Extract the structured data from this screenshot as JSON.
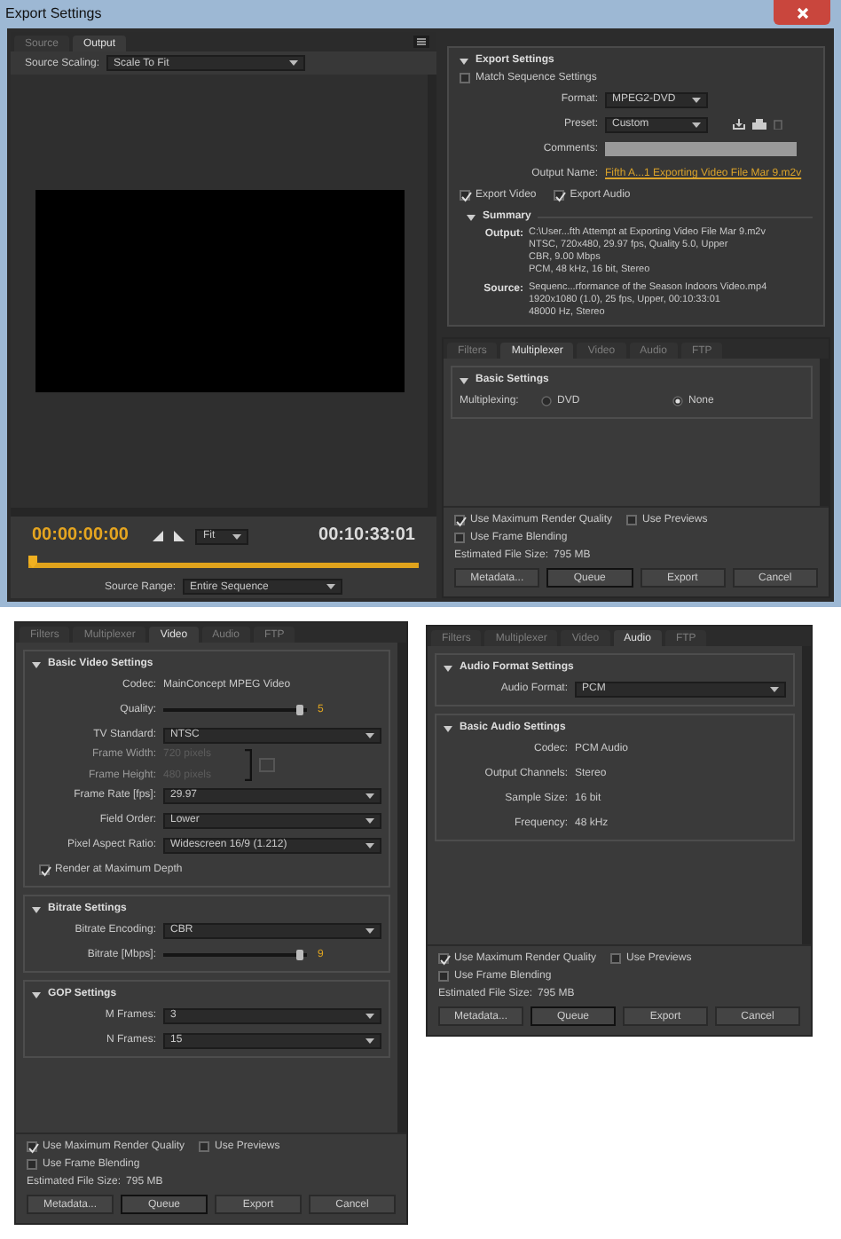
{
  "window": {
    "title": "Export Settings"
  },
  "preview": {
    "tabs": [
      {
        "label": "Source",
        "selected": false
      },
      {
        "label": "Output",
        "selected": true
      }
    ],
    "source_scaling": {
      "label": "Source Scaling:",
      "value": "Scale To Fit"
    },
    "timecode_current": "00:00:00:00",
    "zoom": "Fit",
    "timecode_duration": "00:10:33:01",
    "source_range": {
      "label": "Source Range:",
      "value": "Entire Sequence"
    }
  },
  "export_settings": {
    "heading": "Export Settings",
    "expanded": true,
    "match_sequence": {
      "label": "Match Sequence Settings",
      "checked": false
    },
    "fields": [
      {
        "kind": "dropdown",
        "label": "Format:",
        "value": "MPEG2-DVD"
      },
      {
        "kind": "preset",
        "label": "Preset:",
        "value": "Custom"
      },
      {
        "kind": "input",
        "label": "Comments:"
      },
      {
        "kind": "link",
        "label": "Output Name:",
        "value": "Fifth A...1 Exporting Video File Mar 9.m2v"
      }
    ],
    "exports": [
      {
        "label": "Export Video",
        "checked": true
      },
      {
        "label": "Export Audio",
        "checked": true
      }
    ],
    "summary": {
      "heading": "Summary",
      "expanded": true,
      "entries": [
        {
          "label": "Output:",
          "lines": [
            "C:\\User...fth Attempt at Exporting Video File Mar 9.m2v",
            "NTSC, 720x480, 29.97 fps, Quality 5.0, Upper",
            "CBR, 9.00 Mbps",
            "PCM, 48 kHz, 16 bit, Stereo"
          ]
        },
        {
          "label": "Source:",
          "lines": [
            "Sequenc...rformance of the Season Indoors Video.mp4",
            "1920x1080 (1.0), 25 fps, Upper, 00:10:33:01",
            "48000 Hz, Stereo"
          ]
        }
      ]
    }
  },
  "panels": [
    {
      "tabs": [
        {
          "label": "Filters",
          "selected": false
        },
        {
          "label": "Multiplexer",
          "selected": true
        },
        {
          "label": "Video",
          "selected": false
        },
        {
          "label": "Audio",
          "selected": false
        },
        {
          "label": "FTP",
          "selected": false
        }
      ],
      "sections": [
        {
          "heading": "Basic Settings",
          "expanded": true,
          "rows": [
            {
              "kind": "radio",
              "label": "Multiplexing:",
              "options": [
                {
                  "label": "DVD",
                  "selected": false
                },
                {
                  "label": "None",
                  "selected": true
                }
              ]
            }
          ]
        }
      ],
      "footer": {
        "checkboxes": [
          {
            "label": "Use Maximum Render Quality",
            "checked": true
          },
          {
            "label": "Use Previews",
            "checked": false
          },
          {
            "label": "Use Frame Blending",
            "checked": false
          }
        ],
        "file_size": {
          "label": "Estimated File Size:",
          "value": "795 MB"
        },
        "buttons": [
          {
            "label": "Metadata...",
            "focused": false
          },
          {
            "label": "Queue",
            "focused": true
          },
          {
            "label": "Export",
            "focused": false
          },
          {
            "label": "Cancel",
            "focused": false
          }
        ]
      }
    },
    {
      "tabs": [
        {
          "label": "Filters",
          "selected": false
        },
        {
          "label": "Multiplexer",
          "selected": false
        },
        {
          "label": "Video",
          "selected": true
        },
        {
          "label": "Audio",
          "selected": false
        },
        {
          "label": "FTP",
          "selected": false
        }
      ],
      "sections": [
        {
          "heading": "Basic Video Settings",
          "expanded": true,
          "rows": [
            {
              "kind": "text",
              "label": "Codec:",
              "value": "MainConcept MPEG Video"
            },
            {
              "kind": "slider",
              "label": "Quality:",
              "level": 0.97,
              "reading": "5"
            },
            {
              "kind": "dropdown",
              "label": "TV Standard:",
              "value": "NTSC"
            },
            {
              "kind": "linked_pair",
              "disabled": true,
              "rows": [
                {
                  "label": "Frame Width:",
                  "value": "720 pixels"
                },
                {
                  "label": "Frame Height:",
                  "value": "480 pixels"
                }
              ]
            },
            {
              "kind": "dropdown",
              "label": "Frame Rate [fps]:",
              "value": "29.97"
            },
            {
              "kind": "dropdown",
              "label": "Field Order:",
              "value": "Lower"
            },
            {
              "kind": "dropdown",
              "label": "Pixel Aspect Ratio:",
              "value": "Widescreen 16/9 (1.212)"
            },
            {
              "kind": "checkbox",
              "label": "Render at Maximum Depth",
              "checked": true
            }
          ]
        },
        {
          "heading": "Bitrate Settings",
          "expanded": true,
          "rows": [
            {
              "kind": "dropdown",
              "label": "Bitrate Encoding:",
              "value": "CBR"
            },
            {
              "kind": "slider",
              "label": "Bitrate [Mbps]:",
              "level": 0.97,
              "reading": "9"
            }
          ]
        },
        {
          "heading": "GOP Settings",
          "expanded": true,
          "rows": [
            {
              "kind": "dropdown",
              "label": "M Frames:",
              "value": "3"
            },
            {
              "kind": "dropdown",
              "label": "N Frames:",
              "value": "15"
            }
          ]
        }
      ],
      "footer": {
        "checkboxes": [
          {
            "label": "Use Maximum Render Quality",
            "checked": true
          },
          {
            "label": "Use Previews",
            "checked": false
          },
          {
            "label": "Use Frame Blending",
            "checked": false
          }
        ],
        "file_size": {
          "label": "Estimated File Size:",
          "value": "795 MB"
        },
        "buttons": [
          {
            "label": "Metadata...",
            "focused": false
          },
          {
            "label": "Queue",
            "focused": true
          },
          {
            "label": "Export",
            "focused": false
          },
          {
            "label": "Cancel",
            "focused": false
          }
        ]
      }
    },
    {
      "tabs": [
        {
          "label": "Filters",
          "selected": false
        },
        {
          "label": "Multiplexer",
          "selected": false
        },
        {
          "label": "Video",
          "selected": false
        },
        {
          "label": "Audio",
          "selected": true
        },
        {
          "label": "FTP",
          "selected": false
        }
      ],
      "sections": [
        {
          "heading": "Audio Format Settings",
          "expanded": true,
          "rows": [
            {
              "kind": "dropdown",
              "label": "Audio Format:",
              "value": "PCM"
            }
          ]
        },
        {
          "heading": "Basic Audio Settings",
          "expanded": true,
          "rows": [
            {
              "kind": "text",
              "label": "Codec:",
              "value": "PCM Audio"
            },
            {
              "kind": "text",
              "label": "Output Channels:",
              "value": "Stereo"
            },
            {
              "kind": "text",
              "label": "Sample Size:",
              "value": "16 bit"
            },
            {
              "kind": "text",
              "label": "Frequency:",
              "value": "48 kHz"
            }
          ]
        }
      ],
      "footer": {
        "checkboxes": [
          {
            "label": "Use Maximum Render Quality",
            "checked": true
          },
          {
            "label": "Use Previews",
            "checked": false
          },
          {
            "label": "Use Frame Blending",
            "checked": false
          }
        ],
        "file_size": {
          "label": "Estimated File Size:",
          "value": "795 MB"
        },
        "buttons": [
          {
            "label": "Metadata...",
            "focused": false
          },
          {
            "label": "Queue",
            "focused": true
          },
          {
            "label": "Export",
            "focused": false
          },
          {
            "label": "Cancel",
            "focused": false
          }
        ]
      }
    }
  ]
}
